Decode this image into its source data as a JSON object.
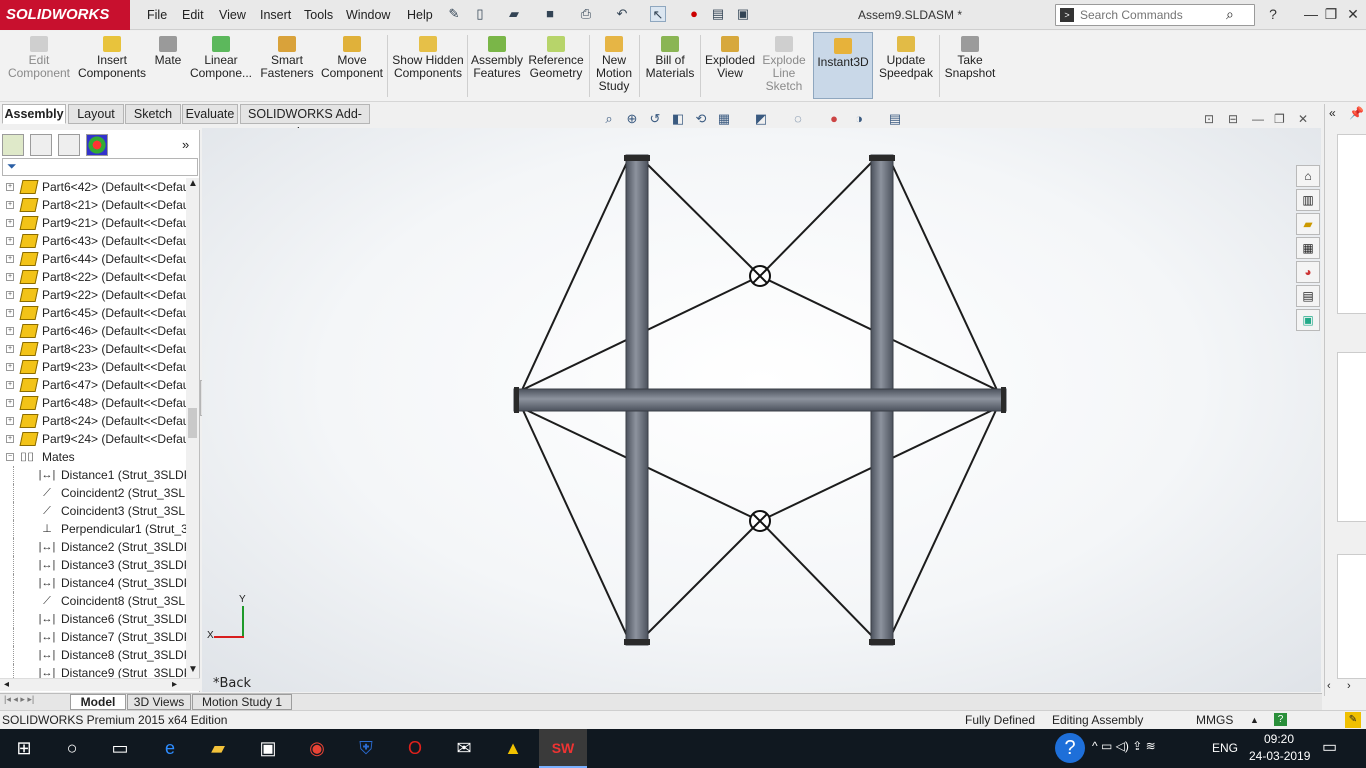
{
  "app": {
    "brand": "SOLIDWORKS",
    "document_title": "Assem9.SLDASM *"
  },
  "menu": [
    "File",
    "Edit",
    "View",
    "Insert",
    "Tools",
    "Window",
    "Help"
  ],
  "search": {
    "placeholder": "Search Commands"
  },
  "ribbon": [
    {
      "label": "Edit Component",
      "disabled": true
    },
    {
      "label": "Insert Components"
    },
    {
      "label": "Mate"
    },
    {
      "label": "Linear Compone..."
    },
    {
      "label": "Smart Fasteners"
    },
    {
      "label": "Move Component"
    },
    {
      "label": "Show Hidden Components"
    },
    {
      "label": "Assembly Features"
    },
    {
      "label": "Reference Geometry"
    },
    {
      "label": "New Motion Study"
    },
    {
      "label": "Bill of Materials"
    },
    {
      "label": "Exploded View"
    },
    {
      "label": "Explode Line Sketch",
      "disabled": true
    },
    {
      "label": "Instant3D",
      "active": true
    },
    {
      "label": "Update Speedpak"
    },
    {
      "label": "Take Snapshot"
    }
  ],
  "command_tabs": [
    "Assembly",
    "Layout",
    "Sketch",
    "Evaluate",
    "SOLIDWORKS Add-Ins"
  ],
  "active_command_tab": "Assembly",
  "feature_tree": {
    "parts": [
      "Part6<42> (Default<<Defau",
      "Part8<21> (Default<<Defau",
      "Part9<21> (Default<<Defau",
      "Part6<43> (Default<<Defau",
      "Part6<44> (Default<<Defau",
      "Part8<22> (Default<<Defau",
      "Part9<22> (Default<<Defau",
      "Part6<45> (Default<<Defau",
      "Part6<46> (Default<<Defau",
      "Part8<23> (Default<<Defau",
      "Part9<23> (Default<<Defau",
      "Part6<47> (Default<<Defau",
      "Part6<48> (Default<<Defau",
      "Part8<24> (Default<<Defau",
      "Part9<24> (Default<<Defau"
    ],
    "mates_folder": "Mates",
    "mates": [
      {
        "label": "Distance1 (Strut_3SLDPF",
        "icon": "distance-mate-icon"
      },
      {
        "label": "Coincident2 (Strut_3SLD",
        "icon": "coincident-mate-icon"
      },
      {
        "label": "Coincident3 (Strut_3SLD",
        "icon": "coincident-mate-icon"
      },
      {
        "label": "Perpendicular1 (Strut_3S",
        "icon": "perpendicular-mate-icon"
      },
      {
        "label": "Distance2 (Strut_3SLDPF",
        "icon": "distance-mate-icon"
      },
      {
        "label": "Distance3 (Strut_3SLDPF",
        "icon": "distance-mate-icon"
      },
      {
        "label": "Distance4 (Strut_3SLDPF",
        "icon": "distance-mate-icon"
      },
      {
        "label": "Coincident8 (Strut_3SLD",
        "icon": "coincident-mate-icon"
      },
      {
        "label": "Distance6 (Strut_3SLDPF",
        "icon": "distance-mate-icon"
      },
      {
        "label": "Distance7 (Strut_3SLDPF",
        "icon": "distance-mate-icon"
      },
      {
        "label": "Distance8 (Strut_3SLDPF",
        "icon": "distance-mate-icon"
      },
      {
        "label": "Distance9 (Strut_3SLDPF",
        "icon": "distance-mate-icon"
      }
    ]
  },
  "viewport": {
    "view_label": "*Back",
    "triad": {
      "x": "X",
      "y": "Y"
    }
  },
  "bottom_tabs": [
    "Model",
    "3D Views",
    "Motion Study 1"
  ],
  "active_bottom_tab": "Model",
  "status": {
    "edition": "SOLIDWORKS Premium 2015 x64 Edition",
    "definition": "Fully Defined",
    "mode": "Editing Assembly",
    "units": "MMGS"
  },
  "taskbar": {
    "language": "ENG",
    "time": "09:20",
    "date": "24-03-2019"
  },
  "colors": {
    "brand": "#c8102e",
    "tube": "#6f7581",
    "active_tool": "#c9d8e8"
  }
}
